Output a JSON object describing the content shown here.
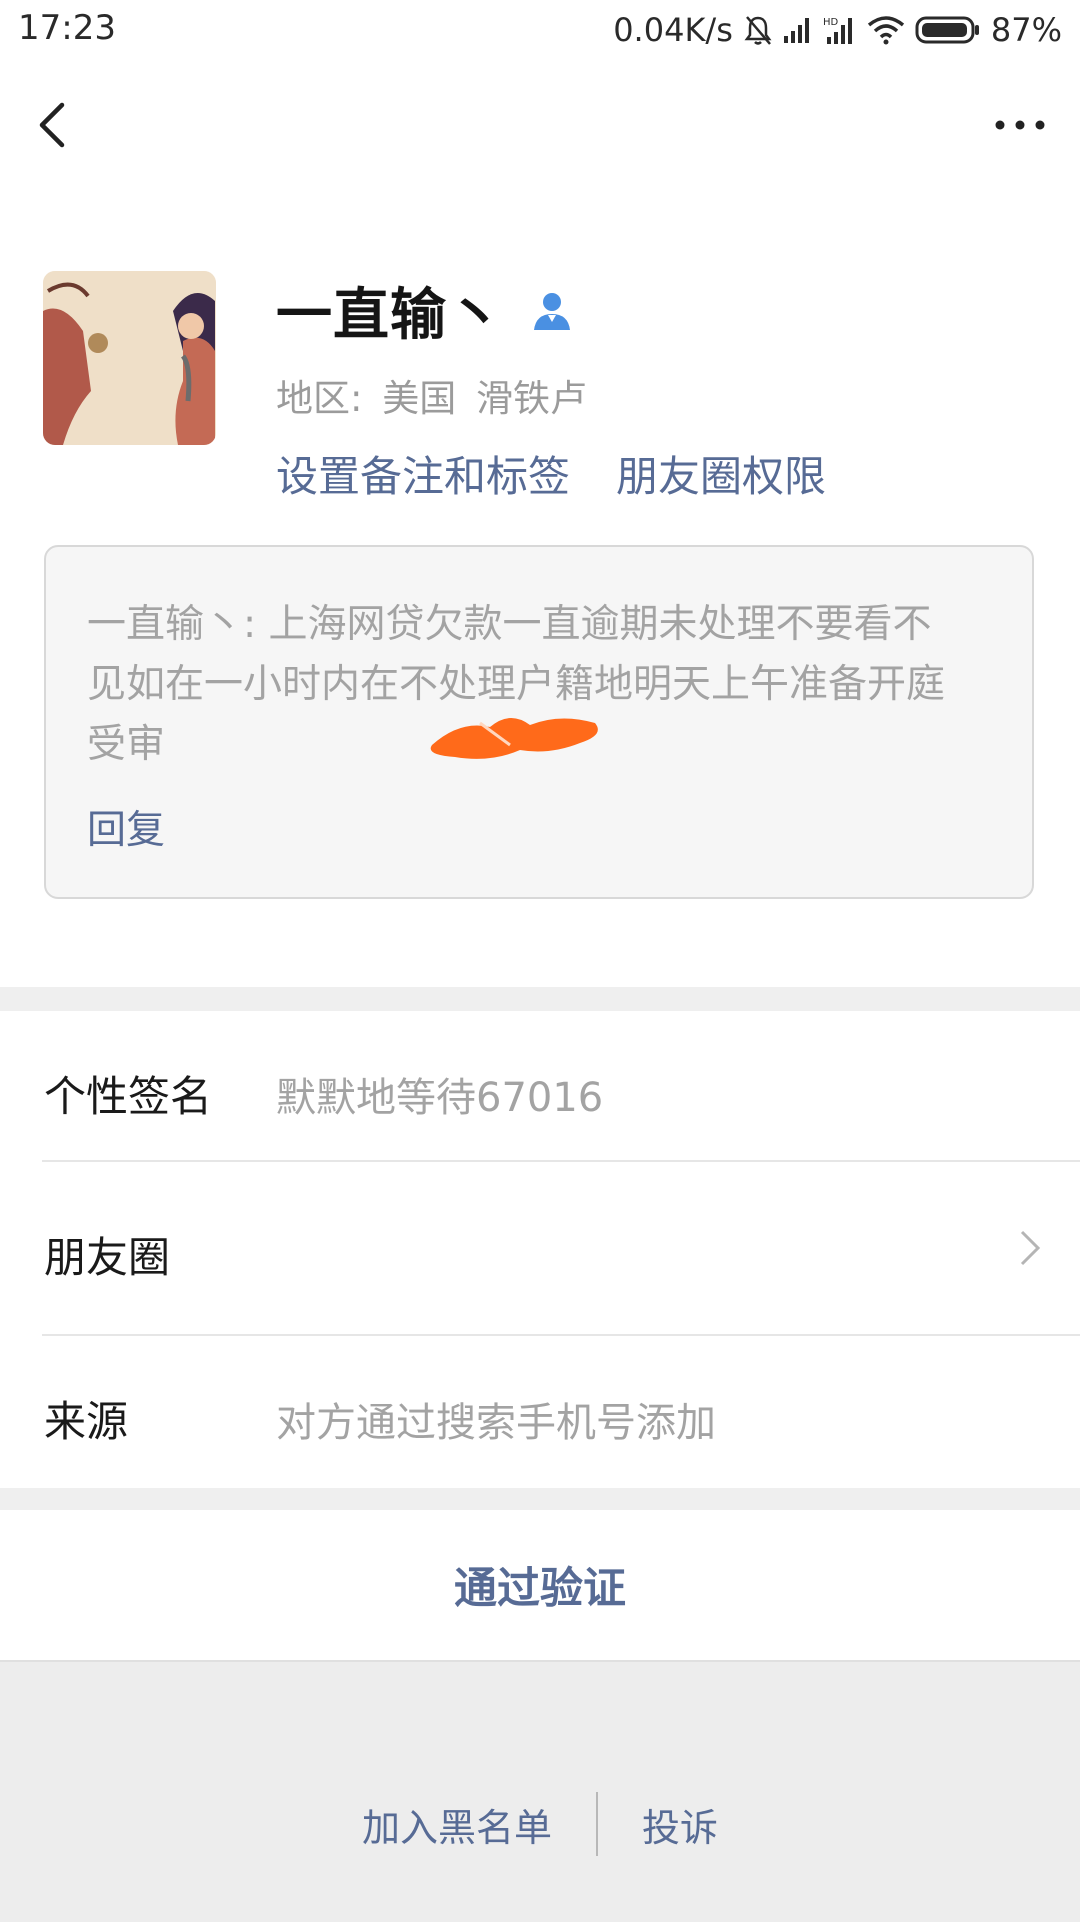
{
  "status": {
    "time": "17:23",
    "speed": "0.04K/s",
    "battery": "87%",
    "icons": [
      "mute-icon",
      "signal-icon",
      "hd-signal-icon",
      "wifi-icon",
      "battery-icon"
    ]
  },
  "nav": {
    "back_icon": "back-arrow-icon",
    "more_icon": "more-dots-icon"
  },
  "profile": {
    "name": "一直输丶",
    "region_label": "地区:",
    "region_country": "美国",
    "region_city": "滑铁卢",
    "remark_link": "设置备注和标签",
    "moments_permission_link": "朋友圈权限"
  },
  "message": {
    "text": "一直输丶: 上海网贷欠款一直逾期未处理不要看不见如在一小时内在不处理户籍地明天上午准备开庭受审",
    "reply": "回复"
  },
  "rows": {
    "signature_label": "个性签名",
    "signature_value": "默默地等待67016",
    "moments_label": "朋友圈",
    "source_label": "来源",
    "source_value": "对方通过搜索手机号添加"
  },
  "actions": {
    "verify": "通过验证",
    "blacklist": "加入黑名单",
    "report": "投诉"
  },
  "colors": {
    "link": "#576b95",
    "secondary_text": "#a3a3a3",
    "separator": "#efefef",
    "redaction": "#ff6a1a"
  }
}
